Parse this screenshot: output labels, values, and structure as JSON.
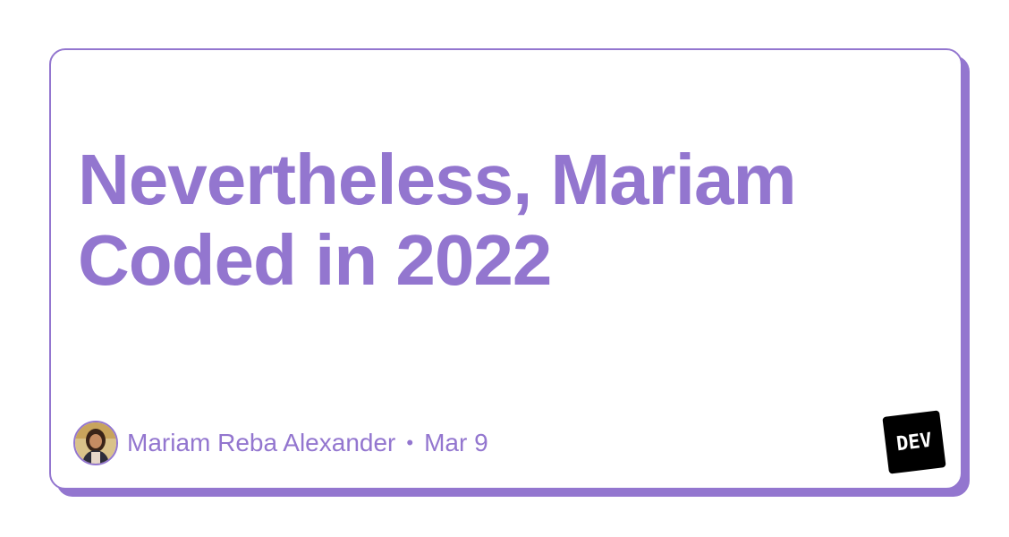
{
  "post": {
    "title_line1": "Nevertheless, Mariam",
    "title_line2": "Coded in 2022",
    "author": "Mariam Reba Alexander",
    "separator": "•",
    "date": "Mar 9"
  },
  "brand": {
    "logo_text": "DEV",
    "accent_color": "#9376cf"
  },
  "icons": {
    "avatar": "author-avatar",
    "logo": "dev-logo"
  }
}
